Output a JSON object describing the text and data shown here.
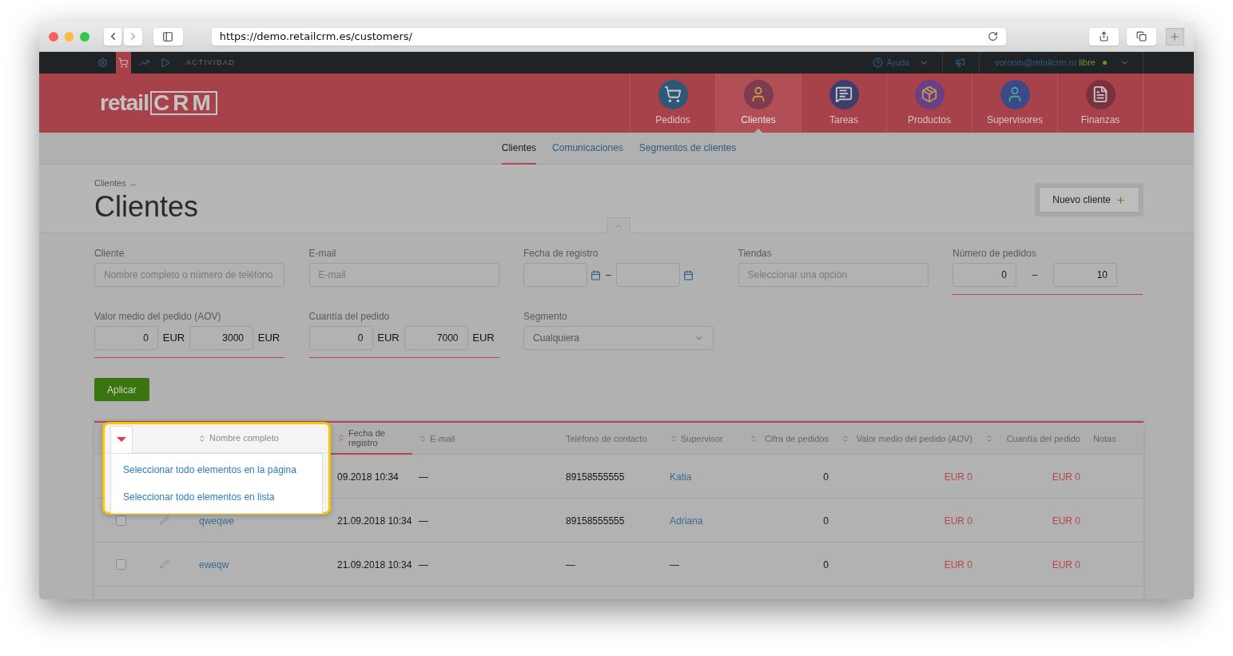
{
  "browser": {
    "url": "https://demo.retailcrm.es/customers/"
  },
  "top_bar": {
    "icons": [
      {
        "kind": "settings",
        "selected": false
      },
      {
        "kind": "cart",
        "selected": true
      },
      {
        "kind": "chart",
        "selected": false
      },
      {
        "kind": "play",
        "selected": false
      }
    ],
    "section_label": "ACTIVIDAD",
    "help": "Ayuda",
    "user_email": "voronin@retailcrm.ru",
    "user_status": "libre"
  },
  "logo": {
    "prefix": "retail",
    "suffix": "CRM"
  },
  "main_nav": [
    {
      "label": "Pedidos",
      "kind": "orders",
      "selected": false
    },
    {
      "label": "Clientes",
      "kind": "customers",
      "selected": true
    },
    {
      "label": "Tareas",
      "kind": "tasks",
      "selected": false
    },
    {
      "label": "Productos",
      "kind": "products",
      "selected": false
    },
    {
      "label": "Supervisores",
      "kind": "managers",
      "selected": false
    },
    {
      "label": "Finanzas",
      "kind": "finance",
      "selected": false
    }
  ],
  "sub_nav": [
    {
      "label": "Clientes",
      "selected": true
    },
    {
      "label": "Comunicaciones",
      "selected": false
    },
    {
      "label": "Segmentos de clientes",
      "selected": false
    }
  ],
  "breadcrumb": "Clientes →",
  "page_title": "Clientes",
  "new_button": "Nuevo cliente",
  "filters": [
    {
      "kind": "text",
      "label": "Cliente",
      "placeholder": "Nombre completo o número de teléfono"
    },
    {
      "kind": "text",
      "label": "E-mail",
      "placeholder": "E-mail"
    },
    {
      "kind": "date_range",
      "label": "Fecha de registro",
      "separator": "–"
    },
    {
      "kind": "select",
      "label": "Tiendas",
      "placeholder": "Seleccionar una opción"
    },
    {
      "kind": "range",
      "label": "Número de pedidos",
      "from": "0",
      "to": "10",
      "separator": "–"
    },
    {
      "kind": "money_range",
      "label": "Valor medio del pedido (AOV)",
      "from": "0",
      "to": "3000",
      "currency_from": "EUR",
      "currency_to": "EUR"
    },
    {
      "kind": "money_range",
      "label": "Cuantía del pedido",
      "from": "0",
      "to": "7000",
      "currency_from": "EUR",
      "currency_to": "EUR"
    },
    {
      "kind": "dropdown",
      "label": "Segmento",
      "value": "Cualquiera"
    }
  ],
  "apply_button": "Aplicar",
  "table": {
    "select_menu": {
      "header_column": {
        "label": "Nombre completo",
        "sortable": true,
        "sorted": false
      },
      "items": [
        "Seleccionar todo elementos en la página",
        "Seleccionar todo elementos en lista"
      ]
    },
    "columns": [
      {
        "label": "Fecha de registro",
        "kind": "date",
        "sortable": true,
        "sorted": true
      },
      {
        "label": "E-mail",
        "kind": "email",
        "sortable": true,
        "sorted": false
      },
      {
        "label": "Teléfono de contacto",
        "kind": "phone",
        "sortable": false,
        "sorted": false
      },
      {
        "label": "Supervisor",
        "kind": "person",
        "sortable": true,
        "sorted": false
      },
      {
        "label": "Cifra de pedidos",
        "kind": "count",
        "sortable": true,
        "sorted": false
      },
      {
        "label": "Valor medio del pedido (AOV)",
        "kind": "money",
        "sortable": true,
        "sorted": false
      },
      {
        "label": "Cuantía del pedido",
        "kind": "money",
        "sortable": true,
        "sorted": false
      },
      {
        "label": "Notas",
        "kind": "notes",
        "sortable": false,
        "sorted": false
      }
    ],
    "rows": [
      {
        "cells": [
          "09.2018 10:34",
          "—",
          "89158555555",
          "Katia",
          "0",
          "EUR 0",
          "EUR 0"
        ]
      },
      {
        "checked": false,
        "name": "qweqwe",
        "cells": [
          "21.09.2018 10:34",
          "—",
          "89158555555",
          "Adriana",
          "0",
          "EUR 0",
          "EUR 0"
        ]
      },
      {
        "checked": false,
        "name": "eweqw",
        "cells": [
          "21.09.2018 10:34",
          "—",
          "—",
          "—",
          "0",
          "EUR 0",
          "EUR 0"
        ]
      }
    ]
  }
}
